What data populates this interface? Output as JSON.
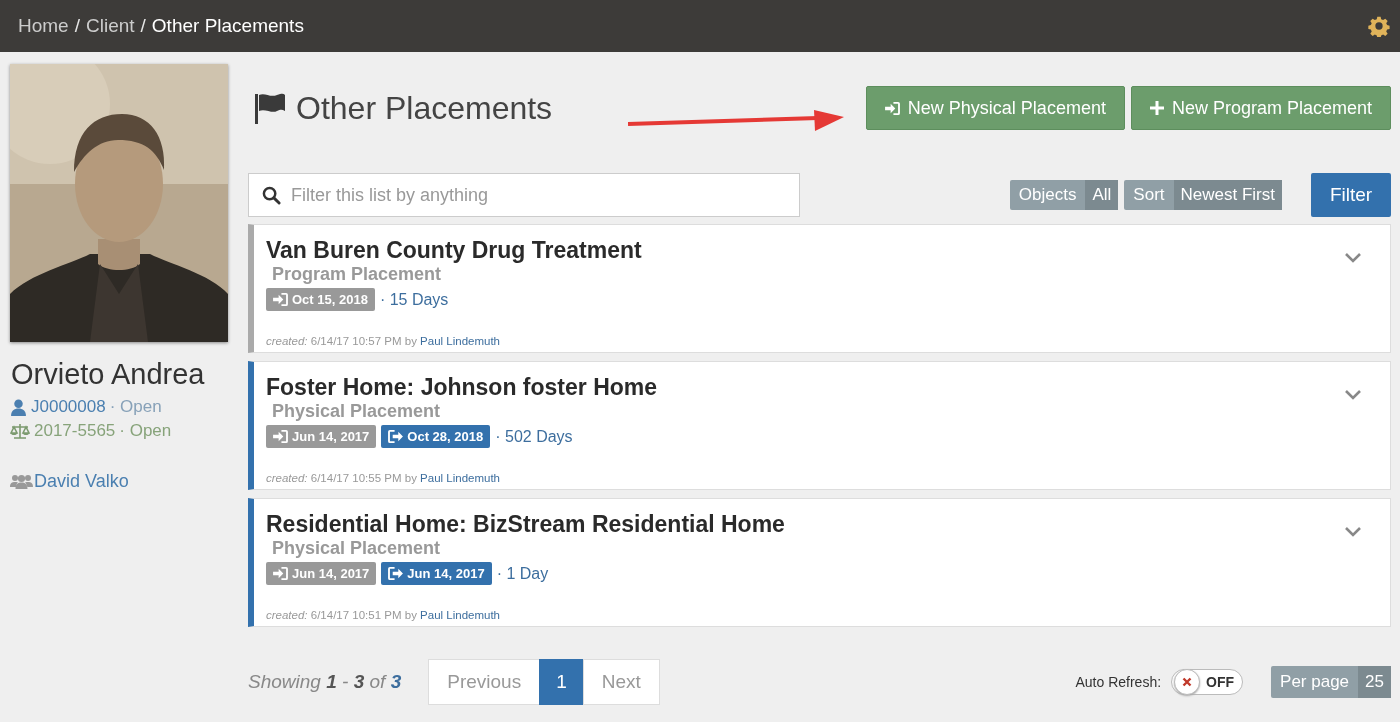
{
  "breadcrumbs": {
    "separator": "/",
    "items": [
      {
        "label": "Home",
        "current": false
      },
      {
        "label": "Client",
        "current": false
      },
      {
        "label": "Other Placements",
        "current": true
      }
    ]
  },
  "profile": {
    "name": "Orvieto Andrea",
    "cases": [
      {
        "kind": "client",
        "number": "J0000008",
        "status": "· Open"
      },
      {
        "kind": "court",
        "number": "2017-5565",
        "status": "· Open"
      }
    ],
    "worker": "David Valko"
  },
  "page": {
    "title": "Other Placements",
    "actions": [
      {
        "kind": "physical",
        "label": "New Physical Placement"
      },
      {
        "kind": "program",
        "label": "New Program Placement"
      }
    ]
  },
  "filters": {
    "search": {
      "placeholder": "Filter this list by anything"
    },
    "objects": {
      "label": "Objects",
      "value": "All"
    },
    "sort": {
      "label": "Sort",
      "value": "Newest First"
    },
    "button": "Filter"
  },
  "placements": [
    {
      "kind": "program",
      "title": "Van Buren County Drug Treatment",
      "type": "Program Placement",
      "dates": [
        {
          "kind": "start",
          "label": "Oct 15, 2018"
        }
      ],
      "duration": "· 15 Days",
      "created": "*created:* 6/14/17 10:57 PM by",
      "author": "Paul Lindemuth"
    },
    {
      "kind": "physical",
      "title": "Foster Home: Johnson foster Home",
      "type": "Physical Placement",
      "dates": [
        {
          "kind": "start",
          "label": "Jun 14, 2017"
        },
        {
          "kind": "end",
          "label": "Oct 28, 2018"
        }
      ],
      "duration": "· 502 Days",
      "created": "*created:* 6/14/17 10:55 PM by",
      "author": "Paul Lindemuth"
    },
    {
      "kind": "physical",
      "title": "Residential Home: BizStream Residential Home",
      "type": "Physical Placement",
      "dates": [
        {
          "kind": "start",
          "label": "Jun 14, 2017"
        },
        {
          "kind": "end",
          "label": "Jun 14, 2017"
        }
      ],
      "duration": "· 1 Day",
      "created": "*created:* 6/14/17 10:51 PM by",
      "author": "Paul Lindemuth"
    }
  ],
  "footer": {
    "showing": "Showing **1** - **3** of **3**",
    "pagination": [
      {
        "kind": "prev",
        "label": "Previous",
        "selected": false
      },
      {
        "kind": "page",
        "label": "1",
        "selected": true
      },
      {
        "kind": "next",
        "label": "Next",
        "selected": false
      }
    ],
    "auto_refresh": {
      "label": "Auto Refresh:",
      "on": false,
      "state_text": "OFF"
    },
    "per_page": {
      "label": "Per page",
      "value": "25"
    }
  }
}
